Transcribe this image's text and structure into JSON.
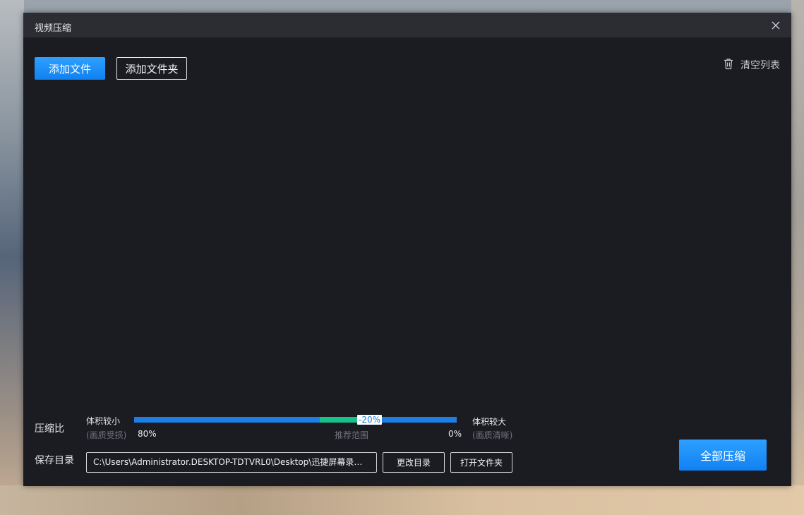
{
  "window": {
    "title": "视频压缩"
  },
  "toolbar": {
    "add_file_label": "添加文件",
    "add_folder_label": "添加文件夹",
    "clear_list_label": "清空列表"
  },
  "compression": {
    "label": "压缩比",
    "left_title": "体积较小",
    "left_subtitle": "(画质受损)",
    "right_title": "体积较大",
    "right_subtitle": "(画质清晰)",
    "min_value": "80%",
    "max_value": "0%",
    "recommended_label": "推荐范围",
    "current_value": "-20%"
  },
  "output": {
    "label": "保存目录",
    "path": "C:\\Users\\Administrator.DESKTOP-TDTVRL0\\Desktop\\迅捷屏幕录像工...",
    "change_dir_label": "更改目录",
    "open_folder_label": "打开文件夹"
  },
  "actions": {
    "compress_all_label": "全部压缩"
  },
  "colors": {
    "accent": "#1181f2",
    "recommended": "#17c38b",
    "window_bg": "#1b1c21",
    "titlebar_bg": "#2b2d33"
  },
  "icons": {
    "close": "close-icon",
    "trash": "trash-icon"
  }
}
